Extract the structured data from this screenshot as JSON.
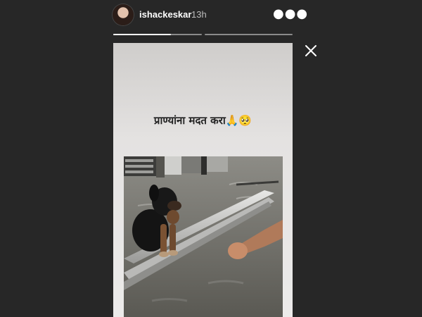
{
  "header": {
    "username": "ishackeskar",
    "time_ago": "13h"
  },
  "progress": [
    {
      "segment": 1,
      "fraction": 0.65
    },
    {
      "segment": 2,
      "fraction": 0
    }
  ],
  "story": {
    "caption": "प्राण्यांना मदत करा🙏🥺",
    "photo": "dog-in-flood-water"
  },
  "icons": {
    "more": "more-options-icon",
    "close": "close-icon"
  },
  "colors": {
    "background": "#272727",
    "progress_fill": "#ffffff",
    "progress_track": "#8a8a8a"
  }
}
